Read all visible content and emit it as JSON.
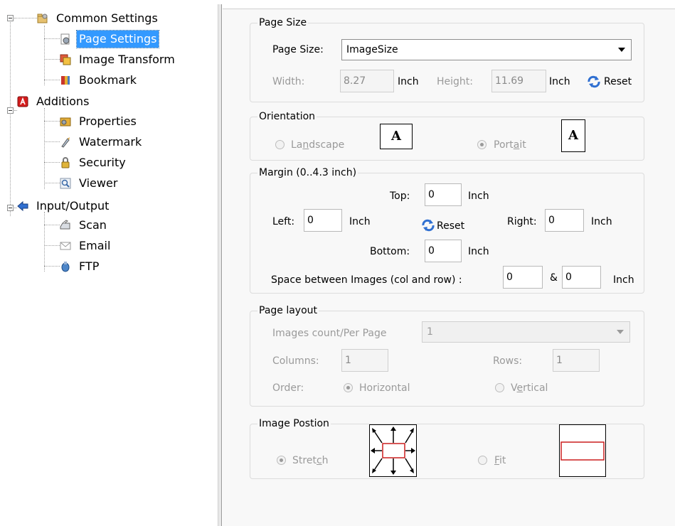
{
  "tree": {
    "items": [
      {
        "label": "Common Settings",
        "icon": "settings-folder-icon"
      },
      {
        "label": "Page Settings",
        "icon": "page-settings-icon"
      },
      {
        "label": "Image Transform",
        "icon": "image-transform-icon"
      },
      {
        "label": "Bookmark",
        "icon": "bookmark-icon"
      },
      {
        "label": "Additions",
        "icon": "pdf-additions-icon"
      },
      {
        "label": "Properties",
        "icon": "properties-icon"
      },
      {
        "label": "Watermark",
        "icon": "watermark-icon"
      },
      {
        "label": "Security",
        "icon": "lock-icon"
      },
      {
        "label": "Viewer",
        "icon": "viewer-icon"
      },
      {
        "label": "Input/Output",
        "icon": "arrow-left-icon"
      },
      {
        "label": "Scan",
        "icon": "scanner-icon"
      },
      {
        "label": "Email",
        "icon": "email-icon"
      },
      {
        "label": "FTP",
        "icon": "ftp-icon"
      }
    ],
    "selected": "Page Settings"
  },
  "page_size": {
    "group_title": "Page Size",
    "size_label": "Page Size:",
    "size_value": "ImageSize",
    "width_label": "Width:",
    "width_value": "8.27",
    "width_unit": "Inch",
    "height_label": "Height:",
    "height_value": "11.69",
    "height_unit": "Inch",
    "reset_label": "Reset"
  },
  "orientation": {
    "group_title": "Orientation",
    "landscape_label": "Landscape",
    "portrait_label": "Portait",
    "icon_letter": "A"
  },
  "margin": {
    "group_title": "Margin (0..4.3 inch)",
    "top_label": "Top:",
    "top_value": "0",
    "left_label": "Left:",
    "left_value": "0",
    "right_label": "Right:",
    "right_value": "0",
    "bottom_label": "Bottom:",
    "bottom_value": "0",
    "unit": "Inch",
    "reset_label": "Reset",
    "space_label": "Space between Images (col and row) :",
    "space_col_value": "0",
    "space_and": "&",
    "space_row_value": "0"
  },
  "page_layout": {
    "group_title": "Page layout",
    "count_label": "Images count/Per Page",
    "count_value": "1",
    "columns_label": "Columns:",
    "columns_value": "1",
    "rows_label": "Rows:",
    "rows_value": "1",
    "order_label": "Order:",
    "horizontal_label": "Horizontal",
    "vertical_label": "Vertical"
  },
  "image_position": {
    "group_title": "Image Postion",
    "stretch_label": "Stretch",
    "fit_label": "Fit"
  },
  "colors": {
    "selection": "#3399ff",
    "panel_bg": "#f8f8f8",
    "disabled_text": "#9a9a9a",
    "frame_red": "#cc1f1f"
  }
}
